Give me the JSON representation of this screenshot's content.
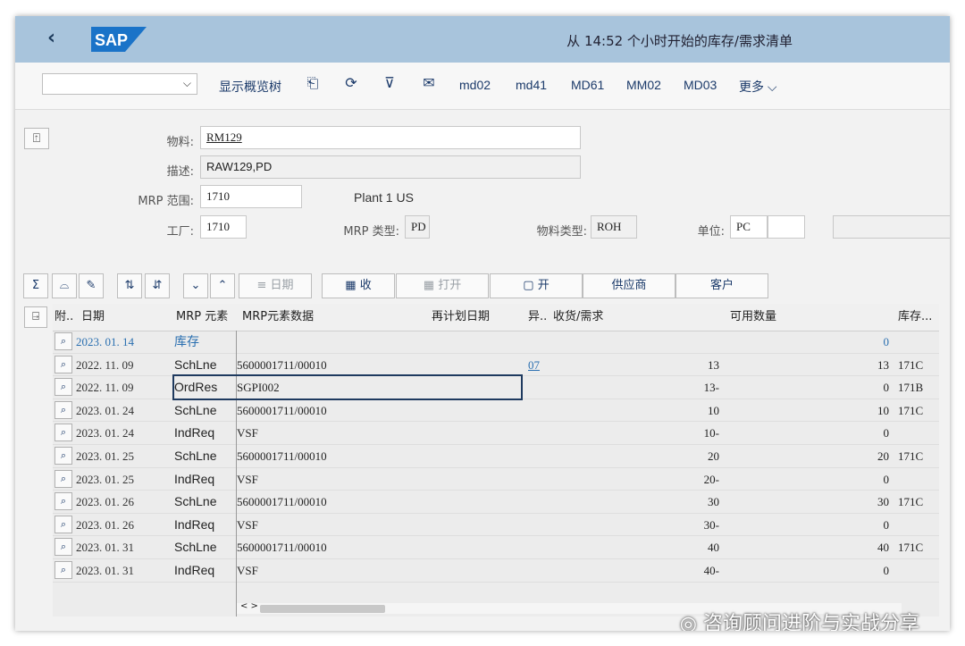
{
  "shell": {
    "title": "从 14:52 个小时开始的库存/需求清单",
    "logo": "SAP",
    "back_icon": "chevron-left-icon"
  },
  "toolbar": {
    "overview_tree": "显示概览树",
    "md02": "md02",
    "md41": "md41",
    "md61": "MD61",
    "mm02": "MM02",
    "md03": "MD03",
    "more": "更多"
  },
  "header": {
    "material_label": "物料:",
    "material": "RM129",
    "desc_label": "描述:",
    "desc": "RAW129,PD",
    "mrp_area_label": "MRP 范围:",
    "mrp_area": "1710",
    "plant_name": "Plant 1 US",
    "plant_label": "工厂:",
    "plant": "1710",
    "mrp_type_label": "MRP 类型:",
    "mrp_type": "PD",
    "mat_type_label": "物料类型:",
    "mat_type": "ROH",
    "unit_label": "单位:",
    "unit": "PC"
  },
  "grid_toolbar": {
    "date": "日期",
    "receive": "收",
    "open": "打开",
    "start": "开",
    "vendor": "供应商",
    "customer": "客户"
  },
  "columns": {
    "att": "附..",
    "date": "日期",
    "mrp_elem": "MRP 元素",
    "mrp_data": "MRP元素数据",
    "resched": "再计划日期",
    "exc": "异..",
    "qty": "收货/需求",
    "avail": "可用数量",
    "stor": "库存..."
  },
  "rows": [
    {
      "date": "2023. 01. 14",
      "elem": "库存",
      "data": "",
      "exc": "",
      "qty": "",
      "avail": "0",
      "stor": ""
    },
    {
      "date": "2022. 11. 09",
      "elem": "SchLne",
      "data": "5600001711/00010",
      "exc": "07",
      "qty": "13",
      "avail": "13",
      "stor": "171C"
    },
    {
      "date": "2022. 11. 09",
      "elem": "OrdRes",
      "data": "SGPI002",
      "exc": "",
      "qty": "13-",
      "avail": "0",
      "stor": "171B"
    },
    {
      "date": "2023. 01. 24",
      "elem": "SchLne",
      "data": "5600001711/00010",
      "exc": "",
      "qty": "10",
      "avail": "10",
      "stor": "171C"
    },
    {
      "date": "2023. 01. 24",
      "elem": "IndReq",
      "data": "VSF",
      "exc": "",
      "qty": "10-",
      "avail": "0",
      "stor": ""
    },
    {
      "date": "2023. 01. 25",
      "elem": "SchLne",
      "data": "5600001711/00010",
      "exc": "",
      "qty": "20",
      "avail": "20",
      "stor": "171C"
    },
    {
      "date": "2023. 01. 25",
      "elem": "IndReq",
      "data": "VSF",
      "exc": "",
      "qty": "20-",
      "avail": "0",
      "stor": ""
    },
    {
      "date": "2023. 01. 26",
      "elem": "SchLne",
      "data": "5600001711/00010",
      "exc": "",
      "qty": "30",
      "avail": "30",
      "stor": "171C"
    },
    {
      "date": "2023. 01. 26",
      "elem": "IndReq",
      "data": "VSF",
      "exc": "",
      "qty": "30-",
      "avail": "0",
      "stor": ""
    },
    {
      "date": "2023. 01. 31",
      "elem": "SchLne",
      "data": "5600001711/00010",
      "exc": "",
      "qty": "40",
      "avail": "40",
      "stor": "171C"
    },
    {
      "date": "2023. 01. 31",
      "elem": "IndReq",
      "data": "VSF",
      "exc": "",
      "qty": "40-",
      "avail": "0",
      "stor": ""
    }
  ],
  "scroll_arrows": "< >",
  "watermark": "咨询顾问进阶与实战分享",
  "colors": {
    "shell": "#a8c4dc",
    "link": "#1b3a6a",
    "stock_row": "#2a6fb0",
    "selection": "#1e3a5f"
  }
}
